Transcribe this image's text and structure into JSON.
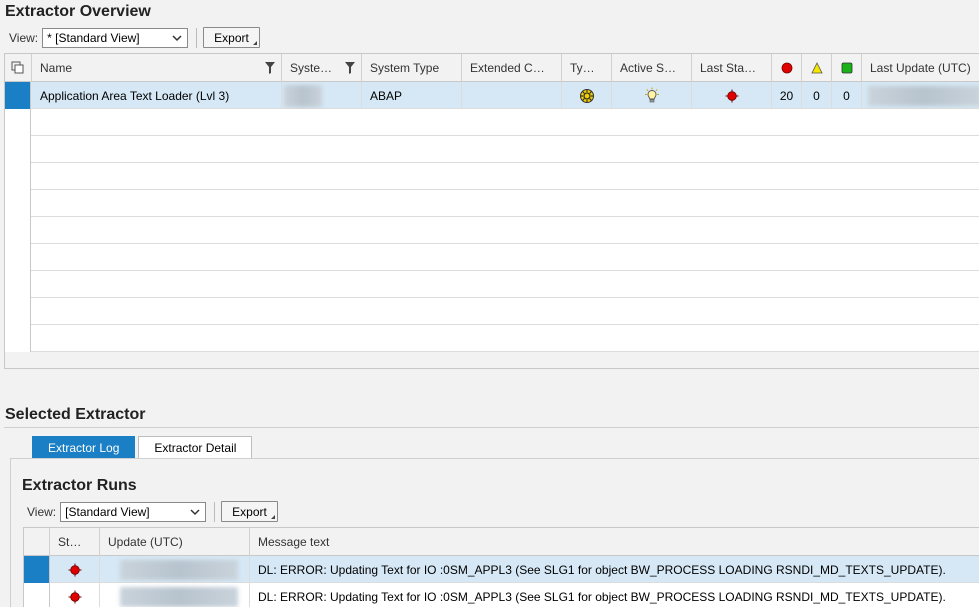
{
  "overview": {
    "title": "Extractor Overview",
    "view_label": "View:",
    "view_value": "* [Standard View]",
    "export_label": "Export",
    "columns": [
      "Name",
      "Syste…",
      "System Type",
      "Extended C…",
      "Ty…",
      "Active S…",
      "Last Sta…",
      "",
      "",
      "",
      "Last Update (UTC)"
    ],
    "rows": [
      {
        "name": "Application Area Text Loader (Lvl 3)",
        "system_type": "ABAP",
        "errors": "20",
        "warnings": "0",
        "ok": "0"
      }
    ]
  },
  "selected": {
    "title": "Selected Extractor",
    "tabs": [
      "Extractor Log",
      "Extractor Detail"
    ],
    "runs_title": "Extractor Runs",
    "view_label": "View:",
    "view_value": "[Standard View]",
    "export_label": "Export",
    "columns": [
      "St…",
      "Update (UTC)",
      "Message text"
    ],
    "rows": [
      {
        "message": "DL: ERROR: Updating Text for IO :0SM_APPL3 (See SLG1 for object BW_PROCESS LOADING RSNDI_MD_TEXTS_UPDATE)."
      },
      {
        "message": "DL: ERROR: Updating Text for IO :0SM_APPL3 (See SLG1 for object BW_PROCESS LOADING RSNDI_MD_TEXTS_UPDATE)."
      }
    ]
  },
  "colors": {
    "accent": "#1a7fc4",
    "selected_row": "#d6e8f5",
    "error": "#e00000",
    "warning": "#f5e600",
    "success": "#19b319"
  },
  "icons": {
    "chevron": "chevron-down-icon",
    "filter": "filter-icon",
    "select_all": "select-all-icon",
    "error_light": "red-light-icon",
    "warning_light": "yellow-triangle-icon",
    "success_light": "green-square-icon",
    "type": "extractor-type-icon",
    "active_status": "lightbulb-icon"
  }
}
